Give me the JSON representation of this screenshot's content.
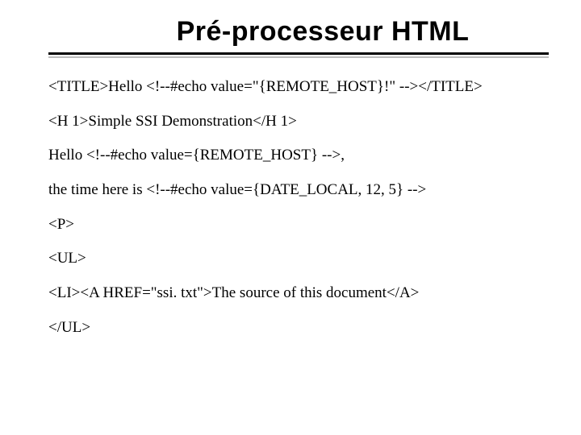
{
  "title": "Pré-processeur HTML",
  "lines": {
    "l0": "<TITLE>Hello <!--#echo value=\"{REMOTE_HOST}!\" --></TITLE>",
    "l1": "<H 1>Simple SSI Demonstration</H 1>",
    "l2": "Hello <!--#echo value={REMOTE_HOST} -->,",
    "l3": "the time here is <!--#echo value={DATE_LOCAL, 12, 5} -->",
    "l4": "<P>",
    "l5": "<UL>",
    "l6": "<LI><A HREF=\"ssi. txt\">The source of this document</A>",
    "l7": "</UL>"
  }
}
